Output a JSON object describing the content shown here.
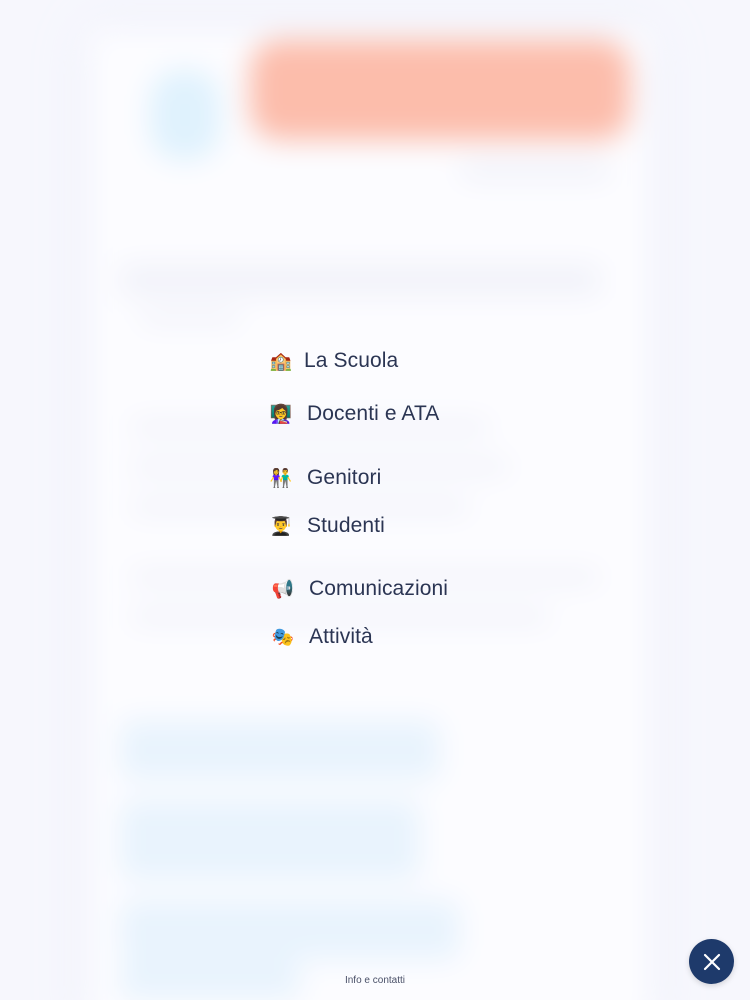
{
  "menu": {
    "items": [
      {
        "label": "La Scuola",
        "icon": "school-icon",
        "glyph": "🏫"
      },
      {
        "label": "Docenti e ATA",
        "icon": "teacher-icon",
        "glyph": "👩‍🏫"
      },
      {
        "label": "Genitori",
        "icon": "parents-icon",
        "glyph": "👫"
      },
      {
        "label": "Studenti",
        "icon": "student-icon",
        "glyph": "👨‍🎓"
      },
      {
        "label": "Comunicazioni",
        "icon": "megaphone-icon",
        "glyph": "📢"
      },
      {
        "label": "Attività",
        "icon": "theater-masks-icon",
        "glyph": "🎭"
      }
    ]
  },
  "footer": {
    "info_label": "Info e contatti"
  },
  "close_button": {
    "icon": "close-icon"
  },
  "colors": {
    "menu_text": "#2b3553",
    "close_button_bg": "#1e3a6b",
    "banner": "#ff7346",
    "logo": "#bfe8fb"
  }
}
